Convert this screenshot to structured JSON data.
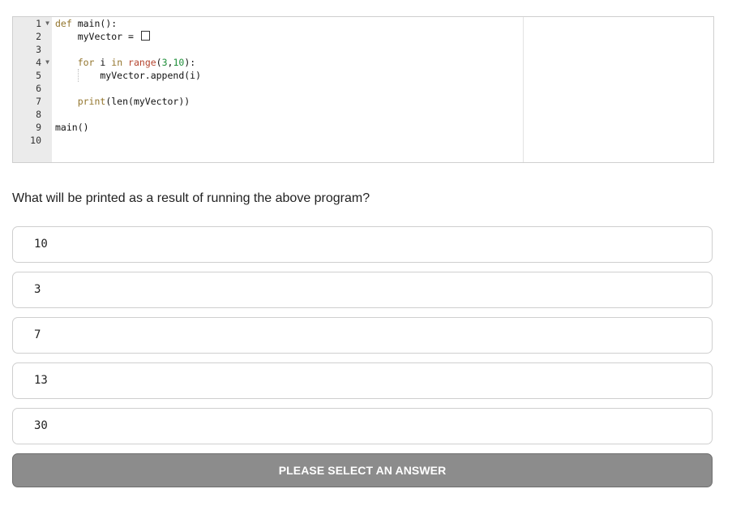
{
  "editor": {
    "line_numbers": [
      "1",
      "2",
      "3",
      "4",
      "5",
      "6",
      "7",
      "8",
      "9",
      "10"
    ],
    "code": {
      "l1_kw": "def",
      "l1_rest": " main():",
      "l2_rest": "    myVector = ",
      "l4_kw": "for",
      "l4_var": " i ",
      "l4_in": "in",
      "l4_range": " range",
      "l4_open": "(",
      "l4_n1": "3",
      "l4_comma": ",",
      "l4_n2": "10",
      "l4_close": "):",
      "l5_rest": "        myVector.append(i)",
      "l7_print": "print",
      "l7_rest": "(len(myVector))",
      "l9_rest": "main()"
    }
  },
  "question": "What will be printed as a result of running the above program?",
  "options": [
    "10",
    "3",
    "7",
    "13",
    "30"
  ],
  "submit_label": "PLEASE SELECT AN ANSWER",
  "colors": {
    "keyword": "#93752d",
    "number": "#1f8f3a",
    "button_bg": "#8c8c8c"
  }
}
